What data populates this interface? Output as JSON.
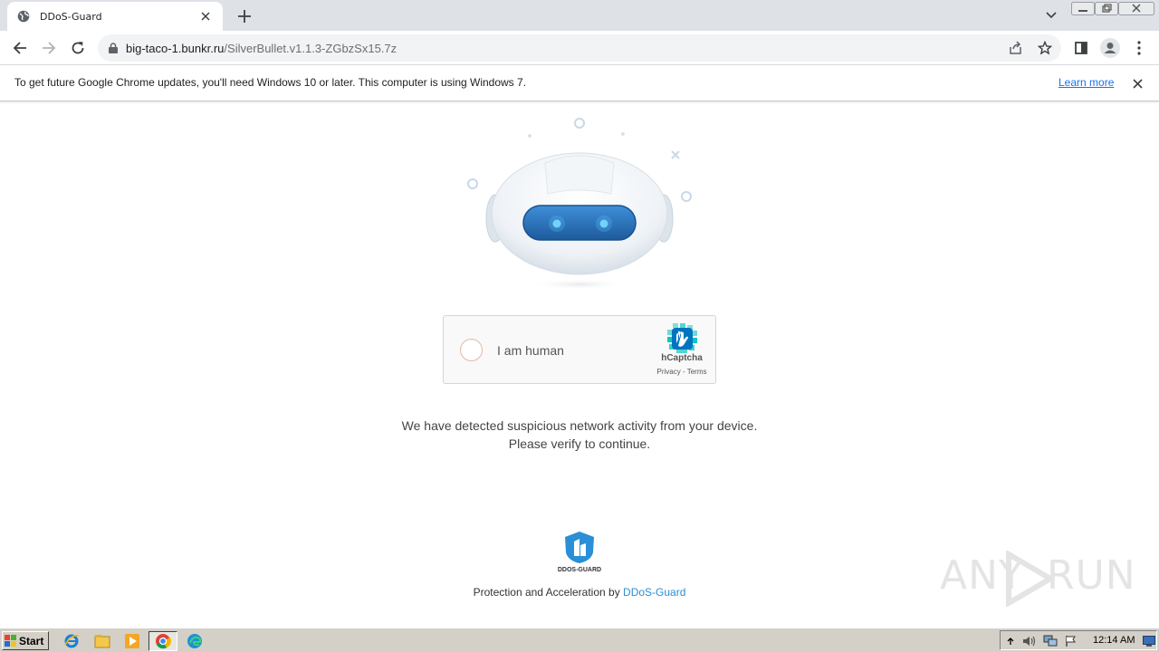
{
  "browser": {
    "tab": {
      "title": "DDoS-Guard",
      "favicon": "globe-icon"
    },
    "address_bar": {
      "host": "big-taco-1.bunkr.ru",
      "path": "/SilverBullet.v1.1.3-ZGbzSx15.7z"
    },
    "toolbar_icons": [
      "back-icon",
      "forward-icon",
      "reload-icon",
      "lock-icon",
      "share-icon",
      "star-icon",
      "side-panel-icon",
      "profile-icon",
      "menu-icon"
    ]
  },
  "infobar": {
    "text": "To get future Google Chrome updates, you'll need Windows 10 or later. This computer is using Windows 7.",
    "link": "Learn more"
  },
  "page": {
    "captcha": {
      "label": "I am human",
      "brand": "hCaptcha",
      "terms": "Privacy - Terms"
    },
    "message_line1": "We have detected suspicious network activity from your device.",
    "message_line2": "Please verify to continue.",
    "logo_text": "DDOS-GUARD",
    "footer_prefix": "Protection and Acceleration by ",
    "footer_link": "DDoS-Guard",
    "watermark_any": "ANY",
    "watermark_run": "RUN"
  },
  "taskbar": {
    "start_label": "Start",
    "clock": "12:14 AM",
    "apps": [
      "ie-icon",
      "explorer-icon",
      "media-player-icon",
      "chrome-icon",
      "edge-icon"
    ]
  },
  "colors": {
    "accent": "#1a73e8",
    "ddos_blue": "#2a8fd6",
    "robot_eye": "#2e7fcf",
    "hcaptcha_teal": "#0ec4c4"
  }
}
